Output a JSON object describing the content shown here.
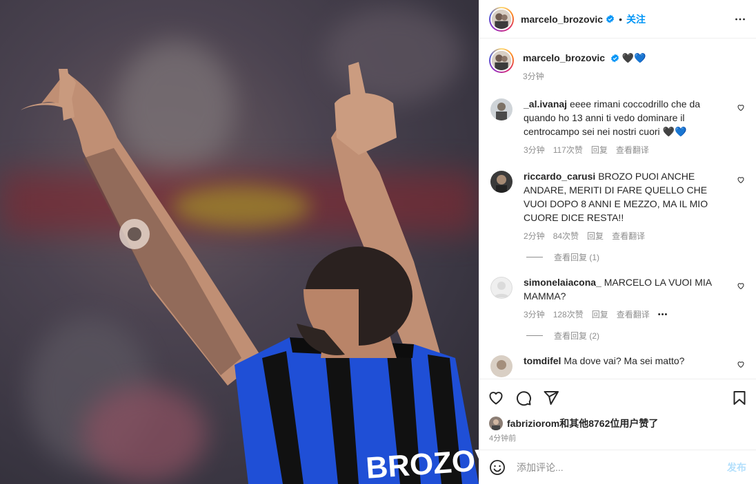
{
  "header": {
    "username": "marcelo_brozovic",
    "separator": "•",
    "follow_label": "关注",
    "more_icon": "more-horizontal-icon"
  },
  "media": {
    "jersey_text": "BROZOVIĆ",
    "alt": "Player celebrating with both arms raised"
  },
  "caption": {
    "username": "marcelo_brozovic",
    "text": "🖤💙",
    "time": "3分钟"
  },
  "comments": [
    {
      "username": "_al.ivanaj",
      "text": "eeee rimani coccodrillo che da quando ho 13 anni ti vedo dominare il centrocampo sei nei nostri cuori 🖤💙",
      "time": "3分钟",
      "likes": "117次赞",
      "reply": "回复",
      "translate": "查看翻译"
    },
    {
      "username": "riccardo_carusi",
      "text": "BROZO PUOI ANCHE ANDARE, MERITI DI FARE QUELLO CHE VUOI DOPO 8 ANNI E MEZZO, MA IL MIO CUORE DICE RESTA!!",
      "time": "2分钟",
      "likes": "84次赞",
      "reply": "回复",
      "translate": "查看翻译",
      "view_replies": "查看回复 (1)"
    },
    {
      "username": "simonelaiacona_",
      "text": "MARCELO LA VUOI MIA MAMMA?",
      "time": "3分钟",
      "likes": "128次赞",
      "reply": "回复",
      "translate": "查看翻译",
      "options": "•••",
      "view_replies": "查看回复 (2)"
    },
    {
      "username": "tomdifel",
      "text": "Ma dove vai? Ma sei matto?"
    }
  ],
  "actions": {
    "like_icon": "heart-icon",
    "comment_icon": "comment-icon",
    "share_icon": "send-icon",
    "save_icon": "bookmark-icon"
  },
  "likes": {
    "text": "fabriziorom和其他8762位用户赞了",
    "time_ago": "4分钟前"
  },
  "add_comment": {
    "placeholder": "添加评论...",
    "post_label": "发布"
  },
  "colors": {
    "accent": "#0095f6",
    "post_disabled": "#b2dffc",
    "muted": "#8e8e8e",
    "jersey_blue": "#1f4fd6",
    "jersey_black": "#111111"
  }
}
